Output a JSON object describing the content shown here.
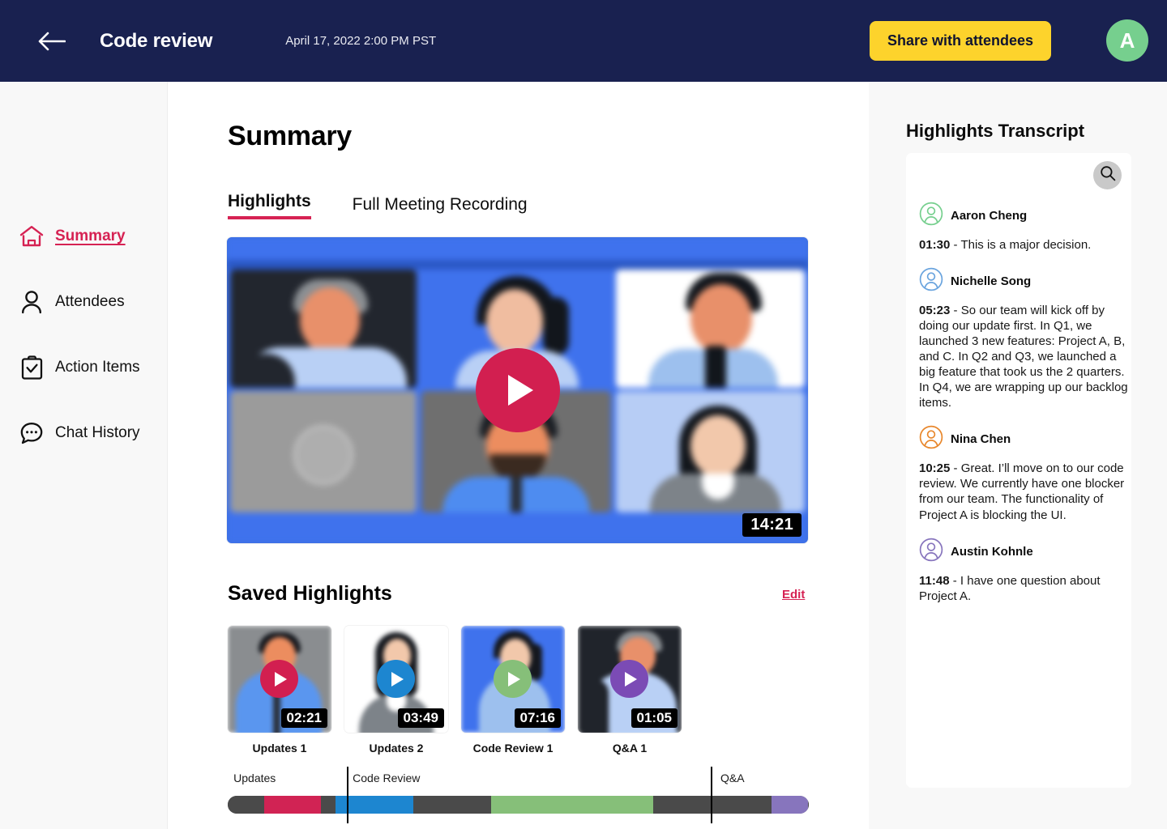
{
  "header": {
    "back_icon": "arrow-left-icon",
    "title": "Code review",
    "date": "April 17, 2022 2:00 PM PST",
    "share_label": "Share with attendees",
    "avatar_initial": "A",
    "bar_color": "#192150",
    "share_color": "#fdd32c",
    "avatar_color": "#76cf8e"
  },
  "sidebar": {
    "items": [
      {
        "label": "Summary",
        "icon": "home-icon",
        "active": true
      },
      {
        "label": "Attendees",
        "icon": "person-icon",
        "active": false
      },
      {
        "label": "Action Items",
        "icon": "clipboard-check-icon",
        "active": false
      },
      {
        "label": "Chat History",
        "icon": "chat-bubble-icon",
        "active": false
      }
    ],
    "accent": "#d62253"
  },
  "main": {
    "page_title": "Summary",
    "tabs": [
      {
        "label": "Highlights",
        "active": true
      },
      {
        "label": "Full Meeting Recording",
        "active": false
      }
    ],
    "player": {
      "duration": "14:21",
      "play_icon": "play-icon",
      "play_color": "#d21f50"
    },
    "saved_highlights": {
      "title": "Saved Highlights",
      "edit_label": "Edit",
      "items": [
        {
          "label": "Updates 1",
          "duration": "02:21",
          "play_color": "#d21f50",
          "bg": "#8a8d90"
        },
        {
          "label": "Updates 2",
          "duration": "03:49",
          "play_color": "#1d86d0",
          "bg": "#ffffff"
        },
        {
          "label": "Code Review 1",
          "duration": "07:16",
          "play_color": "#86bf79",
          "bg": "#3f72ed"
        },
        {
          "label": "Q&A 1",
          "duration": "01:05",
          "play_color": "#7b4bb5",
          "bg": "#20242b"
        }
      ]
    },
    "timeline": {
      "labels": [
        {
          "text": "Updates",
          "left_pct": 1.0
        },
        {
          "text": "Code Review",
          "left_pct": 21.5
        },
        {
          "text": "Q&A",
          "left_pct": 84.8
        }
      ],
      "ticks_pct": [
        20.5,
        83.5
      ],
      "segments": [
        {
          "color": "#4a4a4a",
          "width_pct": 6.3
        },
        {
          "color": "#d12354",
          "width_pct": 9.8
        },
        {
          "color": "#4a4a4a",
          "width_pct": 2.5
        },
        {
          "color": "#1d86d0",
          "width_pct": 13.4
        },
        {
          "color": "#4a4a4a",
          "width_pct": 500.0
        },
        {
          "color": "#86bf79",
          "width_pct": 27.9
        },
        {
          "color": "#4a4a4a",
          "width_pct": 28.5
        },
        {
          "color": "#8775bd",
          "width_pct": 6.2
        },
        {
          "color": "#4a4a4a",
          "width_pct": 5.4
        }
      ]
    }
  },
  "right_panel": {
    "title": "Highlights Transcript",
    "search_icon": "search-icon",
    "entries": [
      {
        "name": "Aaron Cheng",
        "avatar_color": "#76cf8e",
        "time": "01:30",
        "text": "This is a major decision."
      },
      {
        "name": "Nichelle Song",
        "avatar_color": "#6aa4de",
        "time": "05:23",
        "text": "So our team will kick off by doing our update first. In Q1, we launched 3 new features: Project A, B, and C. In Q2 and Q3, we launched a big feature that took us the 2 quarters. In Q4, we are wrapping up our backlog items."
      },
      {
        "name": "Nina Chen",
        "avatar_color": "#e8872c",
        "time": "10:25",
        "text": "Great. I’ll move on to our code review. We currently have one blocker from our team. The functionality of Project A is blocking the UI."
      },
      {
        "name": "Austin Kohnle",
        "avatar_color": "#8775bd",
        "time": "11:48",
        "text": "I have one question about Project A."
      }
    ]
  }
}
